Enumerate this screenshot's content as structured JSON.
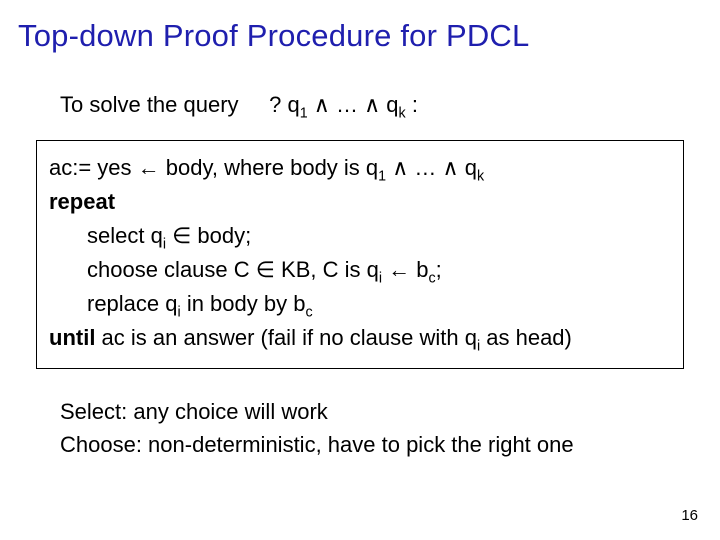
{
  "title": "Top-down Proof Procedure for PDCL",
  "query": {
    "label": "To solve the query",
    "formula": "? q<sub>1</sub> ∧ … ∧ q<sub>k</sub> :"
  },
  "algorithm": {
    "line1": "ac:= yes ← body, where body is q<sub>1</sub> ∧ … ∧ q<sub>k</sub>",
    "repeat": "repeat",
    "step_select": "select q<sub>i</sub> ∈ body;",
    "step_choose": "choose clause C ∈ KB, C is q<sub>i</sub> ← b<sub>c</sub>;",
    "step_replace": "replace q<sub>i</sub> in body by b<sub>c</sub>",
    "until": "<b>until</b> ac is an answer (fail if no clause with q<sub>i</sub> as head)"
  },
  "notes": {
    "select": "Select: any choice will work",
    "choose": "Choose: non-deterministic, have to pick the right one"
  },
  "page_number": "16"
}
